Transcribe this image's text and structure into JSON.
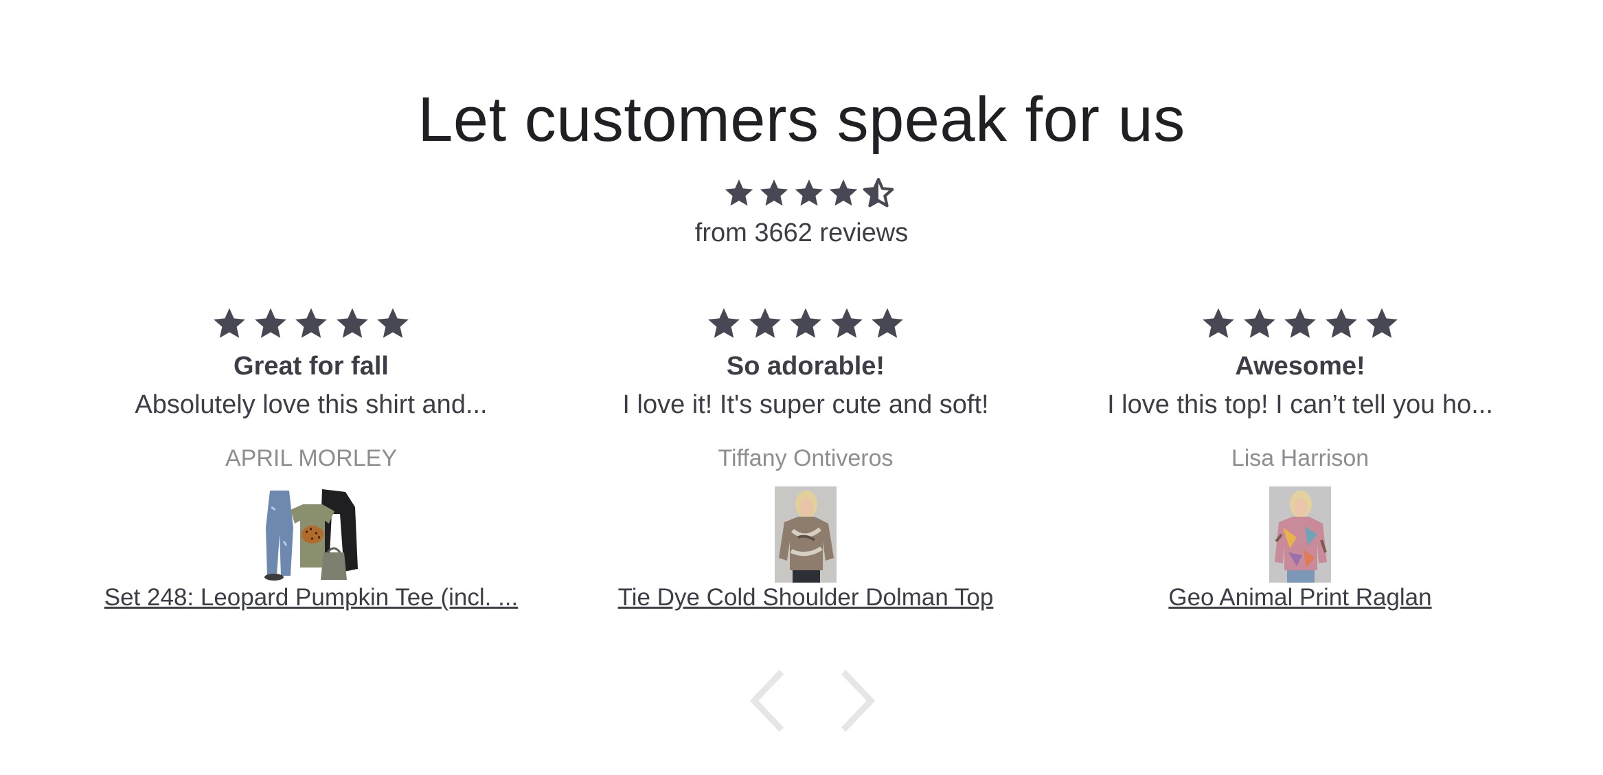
{
  "section": {
    "heading": "Let customers speak for us",
    "summary_rating": 4.5,
    "summary_count_text": "from 3662 reviews",
    "star_color": "#474853"
  },
  "reviews": [
    {
      "rating": 5,
      "title": "Great for fall",
      "body": "Absolutely love this shirt and...",
      "author": "APRIL MORLEY",
      "product_name": "Set 248: Leopard Pumpkin Tee (incl. ..."
    },
    {
      "rating": 5,
      "title": "So adorable!",
      "body": "I love it! It's super cute and soft!",
      "author": "Tiffany Ontiveros",
      "product_name": "Tie Dye Cold Shoulder Dolman Top"
    },
    {
      "rating": 5,
      "title": "Awesome!",
      "body": "I love this top! I can’t tell you ho...",
      "author": "Lisa Harrison",
      "product_name": "Geo Animal Print Raglan"
    }
  ],
  "navigation": {
    "prev_icon": "chevron-left-icon",
    "next_icon": "chevron-right-icon",
    "arrow_color": "#e6e6e6"
  }
}
